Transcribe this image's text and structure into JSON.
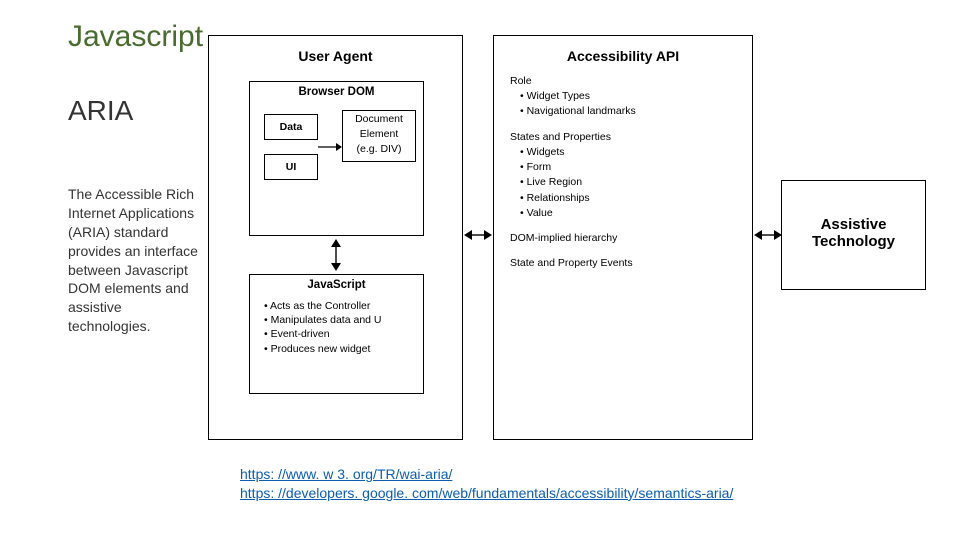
{
  "title": "Javascript",
  "subtitle": "ARIA",
  "body": "The Accessible Rich Internet Applications (ARIA) standard provides an interface between Javascript DOM elements and assistive technologies.",
  "diagram": {
    "col1": {
      "title": "User Agent",
      "browser_dom": "Browser DOM",
      "data": "Data",
      "ui": "UI",
      "doc_elem_line1": "Document",
      "doc_elem_line2": "Element",
      "doc_elem_line3": "(e.g. DIV)",
      "js_title": "JavaScript",
      "js_bullets": [
        "Acts as the Controller",
        "Manipulates data and U",
        "Event-driven",
        "Produces new widget"
      ]
    },
    "col2": {
      "title": "Accessibility API",
      "role_hdr": "Role",
      "role_items": [
        "Widget Types",
        "Navigational landmarks"
      ],
      "sp_hdr": "States and Properties",
      "sp_items": [
        "Widgets",
        "Form",
        "Live Region",
        "Relationships",
        "Value"
      ],
      "dom_hierarchy": "DOM-implied hierarchy",
      "sp_events": "State and Property Events"
    },
    "col3": {
      "title": "Assistive Technology"
    }
  },
  "links": {
    "l1": "https: //www. w 3. org/TR/wai-aria/",
    "l2": "https: //developers. google. com/web/fundamentals/accessibility/semantics-aria/"
  }
}
